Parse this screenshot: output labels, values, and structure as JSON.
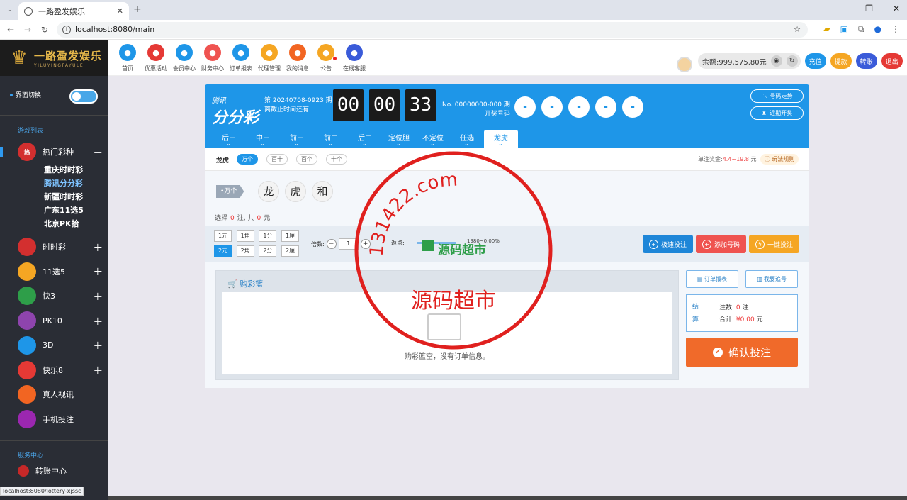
{
  "browser": {
    "tab_title": "一路盈发娱乐",
    "url": "localhost:8080/main",
    "status_url": "localhost:8080/lottery-xjssc"
  },
  "header": {
    "logo_text": "一路盈发娱乐",
    "logo_sub": "YILUYINGFAYULE",
    "nav": [
      {
        "label": "首页",
        "icon": "home-icon",
        "color": "#1e96e8"
      },
      {
        "label": "优惠活动",
        "icon": "gift-icon",
        "color": "#e53935"
      },
      {
        "label": "会员中心",
        "icon": "user-icon",
        "color": "#1e96e8"
      },
      {
        "label": "财务中心",
        "icon": "money-bag-icon",
        "color": "#ef5350"
      },
      {
        "label": "订单报表",
        "icon": "report-icon",
        "color": "#1e96e8"
      },
      {
        "label": "代理管理",
        "icon": "team-icon",
        "color": "#f5a623"
      },
      {
        "label": "我的消息",
        "icon": "message-icon",
        "color": "#f26522"
      },
      {
        "label": "公告",
        "icon": "bell-icon",
        "color": "#f5a623"
      },
      {
        "label": "在线客服",
        "icon": "headset-icon",
        "color": "#3a5bd9"
      }
    ],
    "balance": "余额:999,575.80元",
    "buttons": [
      {
        "label": "充值",
        "color": "#1e96e8"
      },
      {
        "label": "提款",
        "color": "#f5a623"
      },
      {
        "label": "转账",
        "color": "#3a5bd9"
      },
      {
        "label": "退出",
        "color": "#e53935"
      }
    ]
  },
  "sidebar": {
    "switch_label": "界面切换",
    "games_title": "游戏列表",
    "hot": {
      "label": "热门彩种",
      "sym": "−",
      "subs": [
        "重庆时时彩",
        "腾讯分分彩",
        "新疆时时彩",
        "广东11选5",
        "北京PK拾"
      ]
    },
    "items": [
      {
        "label": "时时彩",
        "sym": "+",
        "color": "#d32f2f",
        "icon": "ssc-icon"
      },
      {
        "label": "11选5",
        "sym": "+",
        "color": "#f5a623",
        "icon": "11x5-icon"
      },
      {
        "label": "快3",
        "sym": "+",
        "color": "#2e9e49",
        "icon": "k3-icon"
      },
      {
        "label": "PK10",
        "sym": "+",
        "color": "#8e44ad",
        "icon": "pk10-icon"
      },
      {
        "label": "3D",
        "sym": "+",
        "color": "#1e96e8",
        "icon": "3d-icon"
      },
      {
        "label": "快乐8",
        "sym": "+",
        "color": "#e53935",
        "icon": "kl8-icon"
      },
      {
        "label": "真人视讯",
        "sym": "",
        "color": "#f26522",
        "icon": "live-icon"
      },
      {
        "label": "手机投注",
        "sym": "",
        "color": "#9b27b0",
        "icon": "mobile-icon"
      }
    ],
    "service_title": "服务中心",
    "transfer": "转账中心"
  },
  "lottery": {
    "brand_small": "腾讯",
    "brand_big": "分分彩",
    "issue": "第 20240708-0923 期",
    "deadline": "离截止时间还有",
    "timer": [
      "00",
      "00",
      "33"
    ],
    "draw_no": "No. 00000000-000 期",
    "draw_label": "开奖号码",
    "balls": [
      "-",
      "-",
      "-",
      "-",
      "-"
    ],
    "trend": "号码走势",
    "recent": "近期开奖",
    "tabs": [
      "后三",
      "中三",
      "前三",
      "前二",
      "后二",
      "定位胆",
      "不定位",
      "任选",
      "龙虎"
    ],
    "sub_label": "龙虎",
    "pills": [
      "万个",
      "百十",
      "百个",
      "十个"
    ],
    "odds_label": "单注奖金:",
    "odds": "4.4~19.8",
    "odds_unit": "元",
    "rule": "玩法规则",
    "pos_tag": "万个",
    "choices": [
      "龙",
      "虎",
      "和"
    ],
    "sel_a": "选择",
    "sel_count": "0",
    "sel_b": "注, 共",
    "sel_amount": "0",
    "sel_c": "元",
    "units": [
      "1元",
      "1角",
      "1分",
      "1厘",
      "2元",
      "2角",
      "2分",
      "2厘"
    ],
    "mult_label": "倍数:",
    "mult_value": "1",
    "rebate_label": "返点:",
    "rebate_value": "1980~0.00%",
    "btn_quick": "极速投注",
    "btn_add": "添加号码",
    "btn_one": "一键投注",
    "cart_title": "购彩篮",
    "cart_empty": "购彩篮空，没有订单信息。",
    "report": "订单报表",
    "chase": "我要追号",
    "settle_label": "结算",
    "bet_label": "注数:",
    "bet_count": "0",
    "bet_unit": "注",
    "total_label": "合计:",
    "total": "¥0.00",
    "total_unit": "元",
    "confirm": "确认投注"
  },
  "stamp": {
    "number": "131422.com",
    "text": "源码超市",
    "watermark": "源码超市"
  }
}
